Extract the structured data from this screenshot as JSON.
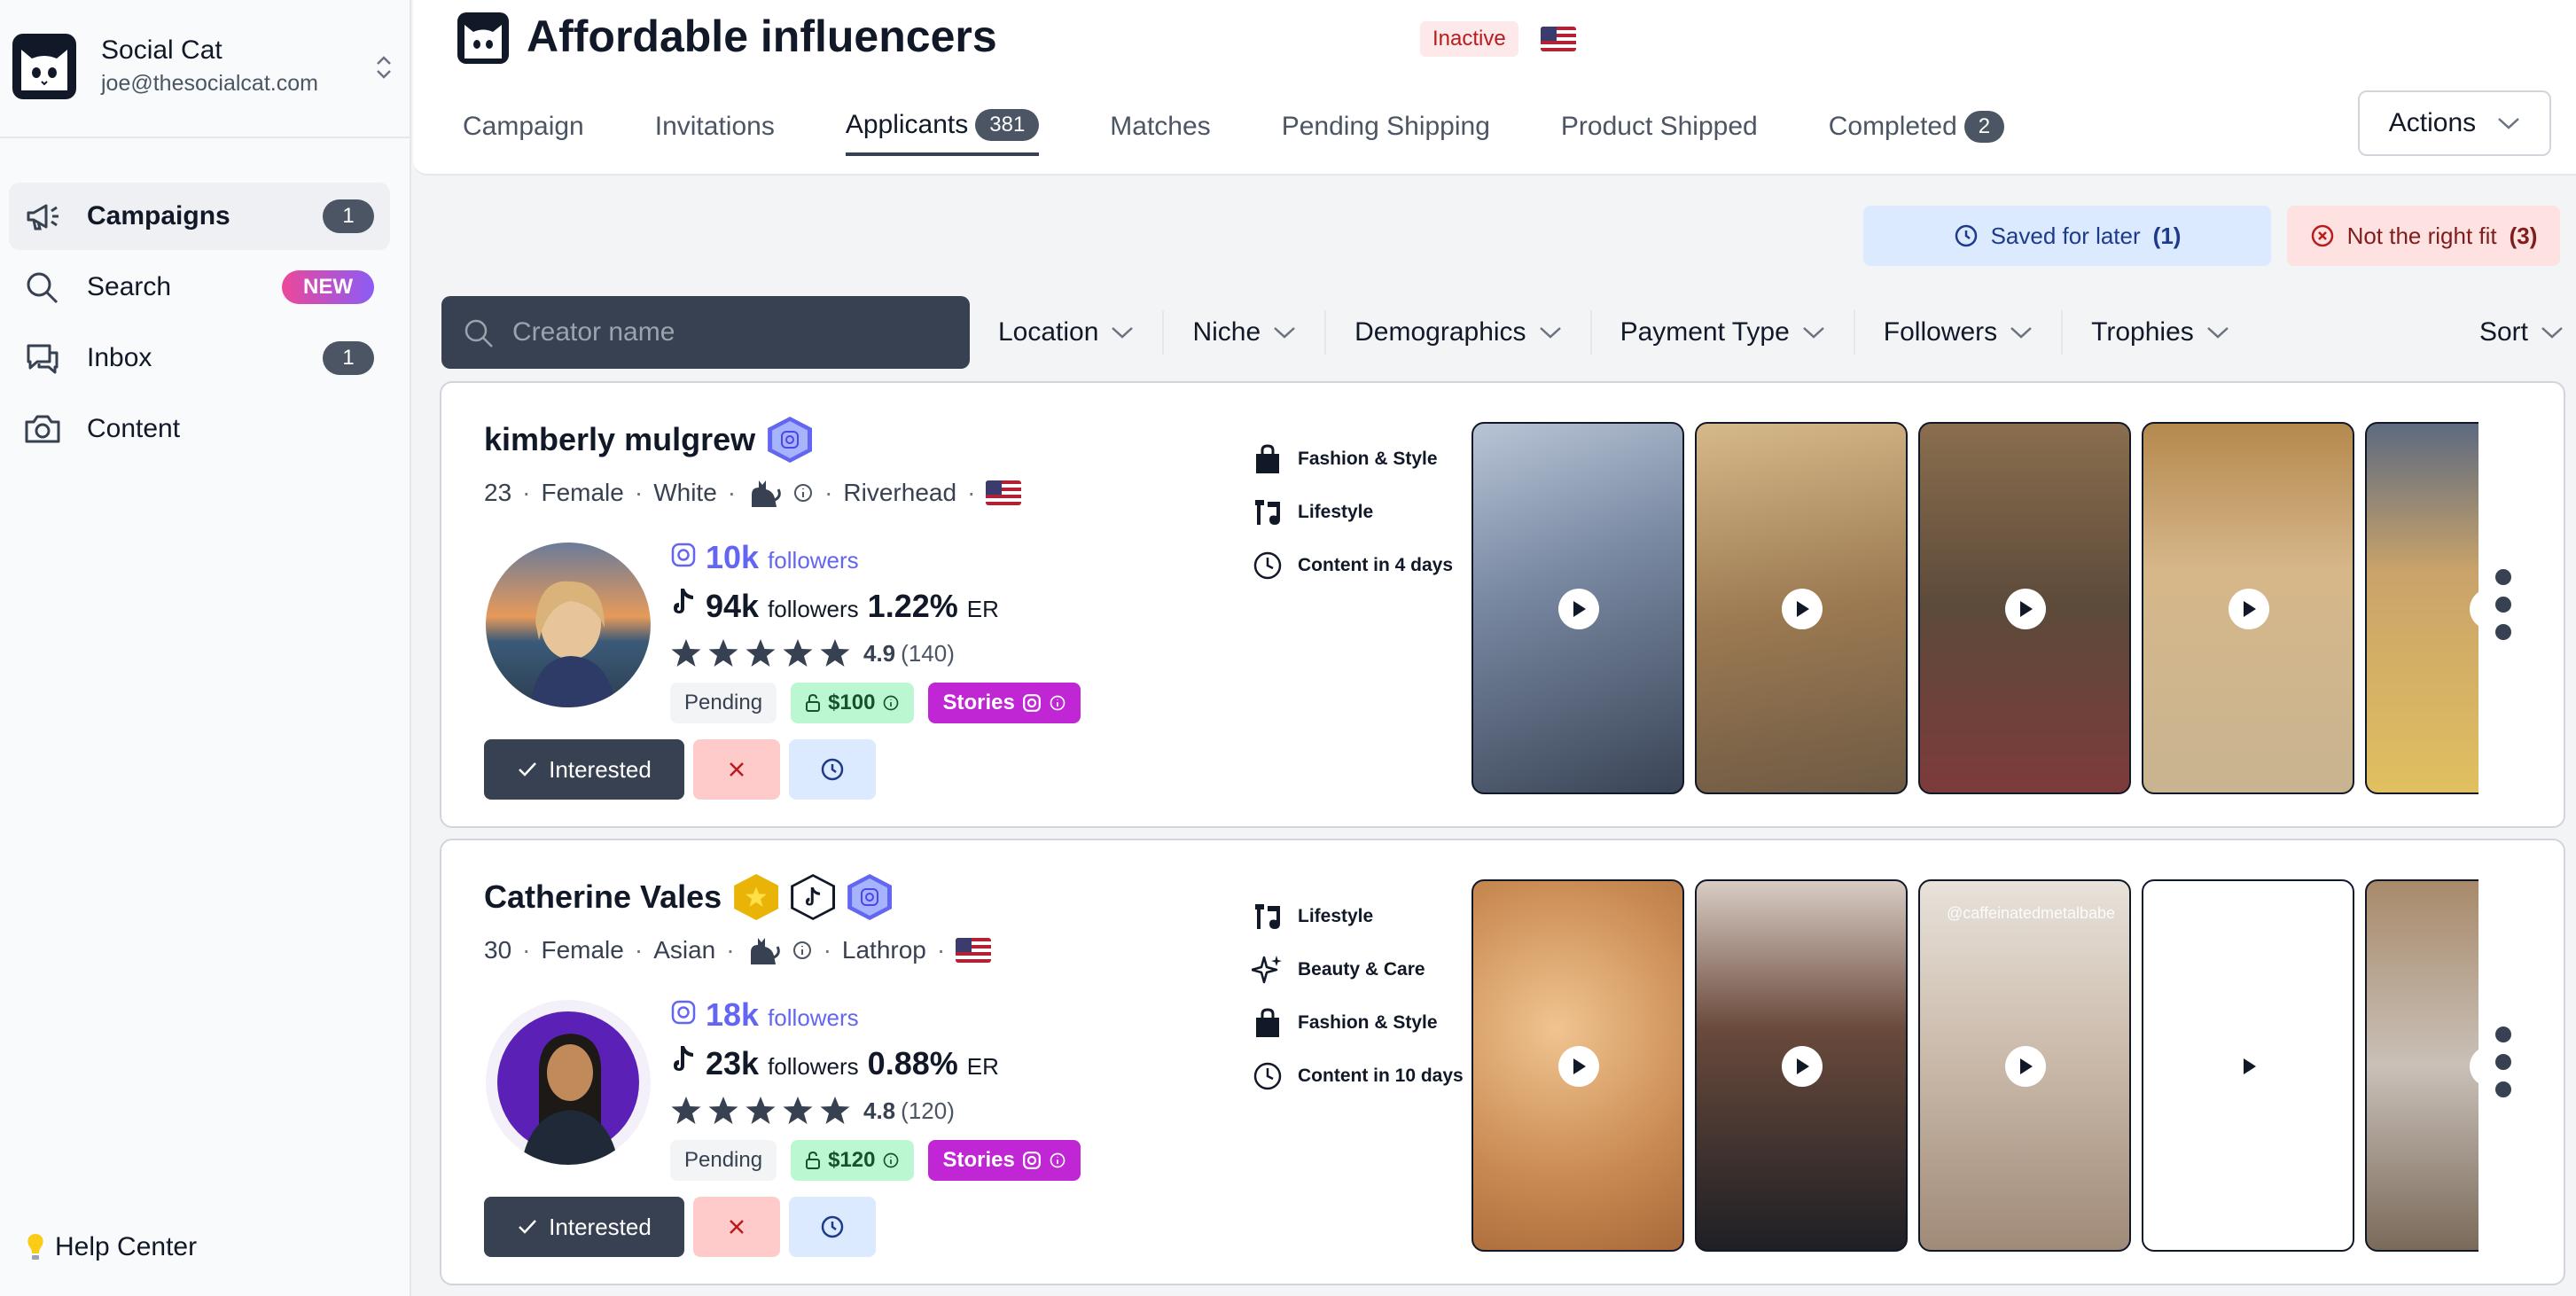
{
  "brand": {
    "name": "Social Cat",
    "email": "joe@thesocialcat.com"
  },
  "sidebar": {
    "items": [
      {
        "label": "Campaigns",
        "badge": "1",
        "icon": "megaphone-icon"
      },
      {
        "label": "Search",
        "badge": "NEW",
        "icon": "search-icon"
      },
      {
        "label": "Inbox",
        "badge": "1",
        "icon": "chat-icon"
      },
      {
        "label": "Content",
        "badge": "",
        "icon": "camera-icon"
      }
    ],
    "help": "Help Center"
  },
  "header": {
    "title": "Affordable influencers",
    "status": "Inactive",
    "actions_label": "Actions",
    "tabs": [
      {
        "label": "Campaign",
        "count": ""
      },
      {
        "label": "Invitations",
        "count": ""
      },
      {
        "label": "Applicants",
        "count": "381"
      },
      {
        "label": "Matches",
        "count": ""
      },
      {
        "label": "Pending Shipping",
        "count": ""
      },
      {
        "label": "Product Shipped",
        "count": ""
      },
      {
        "label": "Completed",
        "count": "2"
      }
    ]
  },
  "saved": {
    "label": "Saved for later",
    "count": "(1)"
  },
  "not_fit": {
    "label": "Not the right fit",
    "count": "(3)"
  },
  "filters": {
    "search_placeholder": "Creator name",
    "items": [
      "Location",
      "Niche",
      "Demographics",
      "Payment Type",
      "Followers",
      "Trophies"
    ],
    "sort": "Sort"
  },
  "creators": [
    {
      "name": "kimberly mulgrew",
      "age": "23",
      "gender": "Female",
      "ethnicity": "White",
      "location": "Riverhead",
      "ig_followers": "10k",
      "followers_word": "followers",
      "tt_followers": "94k",
      "er": "1.22%",
      "er_label": "ER",
      "rating": "4.9",
      "rating_count": "(140)",
      "rating_stars": 5,
      "status": "Pending",
      "price": "$100",
      "format": "Stories",
      "interested": "Interested",
      "tags": [
        {
          "label": "Fashion & Style",
          "icon": "shopping-bag-icon"
        },
        {
          "label": "Lifestyle",
          "icon": "lifestyle-icon"
        },
        {
          "label": "Content in 4 days",
          "icon": "clock-icon"
        }
      ],
      "thumb_colors": [
        "#8ea0b8",
        "#a68a64",
        "#6b5a48",
        "#c29a6a",
        "#c98a3a"
      ],
      "thumb_caption": ""
    },
    {
      "name": "Catherine Vales",
      "age": "30",
      "gender": "Female",
      "ethnicity": "Asian",
      "location": "Lathrop",
      "ig_followers": "18k",
      "followers_word": "followers",
      "tt_followers": "23k",
      "er": "0.88%",
      "er_label": "ER",
      "rating": "4.8",
      "rating_count": "(120)",
      "rating_stars": 5,
      "status": "Pending",
      "price": "$120",
      "format": "Stories",
      "interested": "Interested",
      "tags": [
        {
          "label": "Lifestyle",
          "icon": "lifestyle-icon"
        },
        {
          "label": "Beauty & Care",
          "icon": "sparkle-icon"
        },
        {
          "label": "Fashion & Style",
          "icon": "shopping-bag-icon"
        },
        {
          "label": "Content in 10 days",
          "icon": "clock-icon"
        }
      ],
      "thumb_colors": [
        "#d9a26a",
        "#4a3b38",
        "#c7b8a8",
        "#8c8f96",
        "#a09080"
      ],
      "thumb_caption": "@caffeinatedmetalbabe"
    }
  ],
  "colors": {
    "accent": "#6366f1",
    "dark": "#374151",
    "stories": "#c026d3",
    "price_bg": "#bbf7d0"
  }
}
